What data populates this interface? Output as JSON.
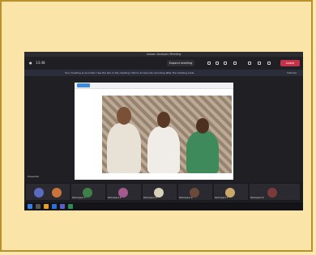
{
  "meeting": {
    "title": "Lesson Analysis Meeting",
    "timer": "13:48",
    "expand_label": "Expand meeting",
    "leave_label": "Leave",
    "banner_text": "Your meeting is recorded. Use the link in the meeting chat to access the recording after the meeting ends.",
    "banner_dismiss": "Dismiss",
    "self_label": "Presenter"
  },
  "participants": [
    {
      "name": "Participant 1",
      "color": "#5b6bc0"
    },
    {
      "name": "Participant 2",
      "color": "#c8743a"
    },
    {
      "name": "Participant 3",
      "color": "#3f7f4a"
    },
    {
      "name": "Participant 4",
      "color": "#a35a8e"
    },
    {
      "name": "Participant 5",
      "color": "#d8d0b8"
    },
    {
      "name": "Participant 6",
      "color": "#6a4a3a"
    },
    {
      "name": "Participant 7",
      "color": "#c9a86a"
    },
    {
      "name": "Participant 8",
      "color": "#7d3a3a"
    }
  ]
}
